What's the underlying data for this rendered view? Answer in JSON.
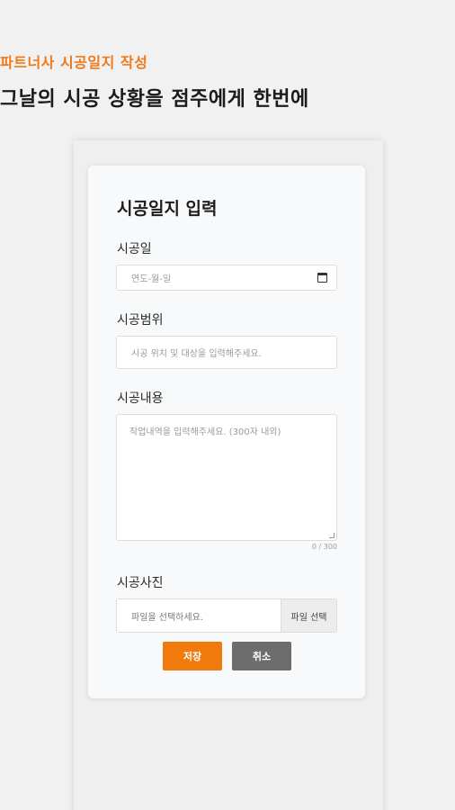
{
  "header": {
    "subtitle": "파트너사 시공일지 작성",
    "headline": "그날의 시공 상황을 점주에게 한번에"
  },
  "form": {
    "title": "시공일지 입력",
    "date": {
      "label": "시공일",
      "placeholder": "연도-월-일"
    },
    "scope": {
      "label": "시공범위",
      "placeholder": "시공 위치 및 대상을 입력해주세요."
    },
    "content": {
      "label": "시공내용",
      "placeholder": "작업내역을 입력해주세요. (300자 내외)",
      "counter": "0 / 300"
    },
    "photo": {
      "label": "시공사진",
      "placeholder": "파일을 선택하세요.",
      "button": "파일 선택"
    },
    "save_label": "저장",
    "cancel_label": "취소"
  },
  "colors": {
    "accent": "#f07a0c",
    "cancel": "#6d6d6d",
    "background": "#f1f1f2"
  }
}
